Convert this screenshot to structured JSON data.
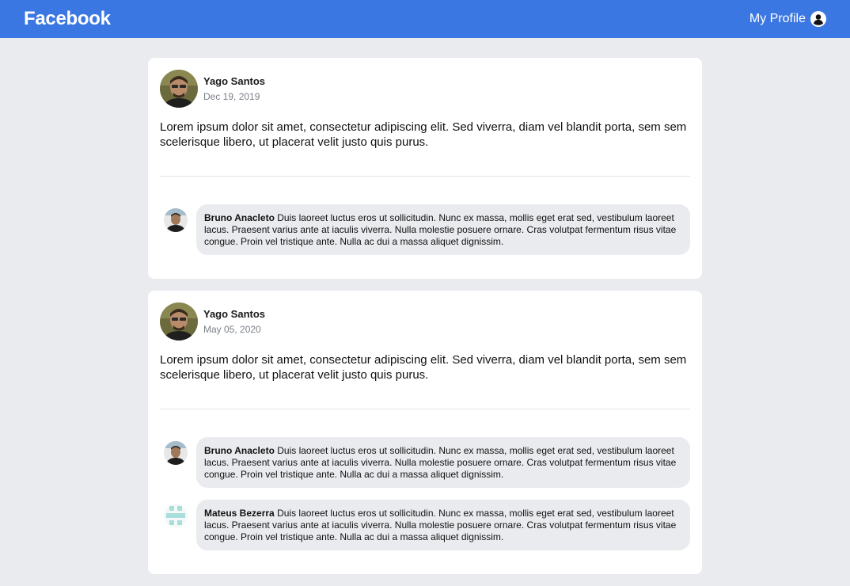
{
  "header": {
    "brand": "Facebook",
    "profile_label": "My Profile",
    "profile_icon": "user-circle-icon",
    "background_color": "#3b77e3"
  },
  "posts": [
    {
      "author": "Yago Santos",
      "date": "Dec 19, 2019",
      "content": "Lorem ipsum dolor sit amet, consectetur adipiscing elit. Sed viverra, diam vel blandit porta, sem sem scelerisque libero, ut placerat velit justo quis purus.",
      "comments": [
        {
          "author": "Bruno Anacleto",
          "text": "Duis laoreet luctus eros ut sollicitudin. Nunc ex massa, mollis eget erat sed, vestibulum laoreet lacus. Praesent varius ante at iaculis viverra. Nulla molestie posuere ornare. Cras volutpat fermentum risus vitae congue. Proin vel tristique ante. Nulla ac dui a massa aliquet dignissim."
        }
      ]
    },
    {
      "author": "Yago Santos",
      "date": "May 05, 2020",
      "content": "Lorem ipsum dolor sit amet, consectetur adipiscing elit. Sed viverra, diam vel blandit porta, sem sem scelerisque libero, ut placerat velit justo quis purus.",
      "comments": [
        {
          "author": "Bruno Anacleto",
          "text": "Duis laoreet luctus eros ut sollicitudin. Nunc ex massa, mollis eget erat sed, vestibulum laoreet lacus. Praesent varius ante at iaculis viverra. Nulla molestie posuere ornare. Cras volutpat fermentum risus vitae congue. Proin vel tristique ante. Nulla ac dui a massa aliquet dignissim."
        },
        {
          "author": "Mateus Bezerra",
          "text": "Duis laoreet luctus eros ut sollicitudin. Nunc ex massa, mollis eget erat sed, vestibulum laoreet lacus. Praesent varius ante at iaculis viverra. Nulla molestie posuere ornare. Cras volutpat fermentum risus vitae congue. Proin vel tristique ante. Nulla ac dui a massa aliquet dignissim."
        }
      ]
    }
  ]
}
